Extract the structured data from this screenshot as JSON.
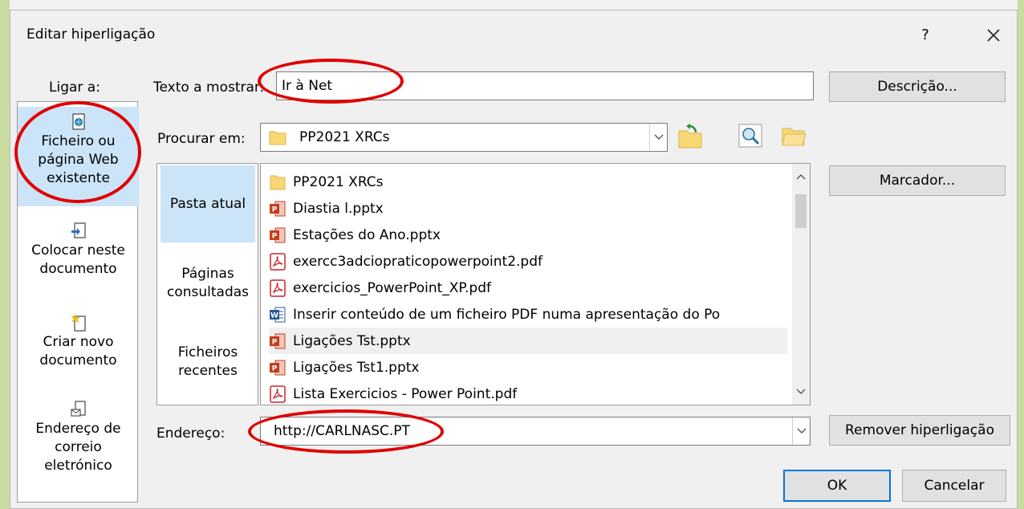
{
  "dialog": {
    "title": "Editar hiperligação",
    "help": "?",
    "close": "✕"
  },
  "link_to": {
    "label": "Ligar a:",
    "items": [
      {
        "line1": "Ficheiro ou",
        "line2": "página Web",
        "line3": "existente",
        "icon": "existing-file-web-icon",
        "selected": true
      },
      {
        "line1": "Colocar neste",
        "line2": "documento",
        "icon": "place-in-document-icon"
      },
      {
        "line1": "Criar novo",
        "line2": "documento",
        "icon": "create-new-document-icon"
      },
      {
        "line1": "Endereço de",
        "line2": "correio",
        "line3": "eletrónico",
        "icon": "email-address-icon"
      }
    ]
  },
  "text_to_display": {
    "label": "Texto a mostrar:",
    "value": "Ir à Net"
  },
  "look_in": {
    "label": "Procurar em:",
    "value": "PP2021 XRCs"
  },
  "sources": {
    "current_folder": "Pasta atual",
    "browsed_pages_1": "Páginas",
    "browsed_pages_2": "consultadas",
    "recent_files_1": "Ficheiros",
    "recent_files_2": "recentes"
  },
  "files": [
    {
      "name": "PP2021 XRCs",
      "type": "folder"
    },
    {
      "name": "Diastia l.pptx",
      "type": "pptx"
    },
    {
      "name": "Estações do Ano.pptx",
      "type": "pptx"
    },
    {
      "name": "exercc3adciopraticopowerpoint2.pdf",
      "type": "pdf"
    },
    {
      "name": "exercicios_PowerPoint_XP.pdf",
      "type": "pdf"
    },
    {
      "name": "Inserir conteúdo de um ficheiro PDF numa apresentação do Po",
      "type": "docx"
    },
    {
      "name": "Ligações Tst.pptx",
      "type": "pptx"
    },
    {
      "name": "Ligações Tst1.pptx",
      "type": "pptx"
    },
    {
      "name": "Lista Exercicios - Power Point.pdf",
      "type": "pdf"
    }
  ],
  "address": {
    "label": "Endereço:",
    "value": "http://CARLNASC.PT"
  },
  "buttons": {
    "screen_tip": "Descrição...",
    "bookmark": "Marcador...",
    "remove_link": "Remover hiperligação",
    "ok": "OK",
    "cancel": "Cancelar"
  },
  "colors": {
    "selection": "#cce4f7",
    "annotation": "#e00000",
    "accent": "#0078d7"
  }
}
